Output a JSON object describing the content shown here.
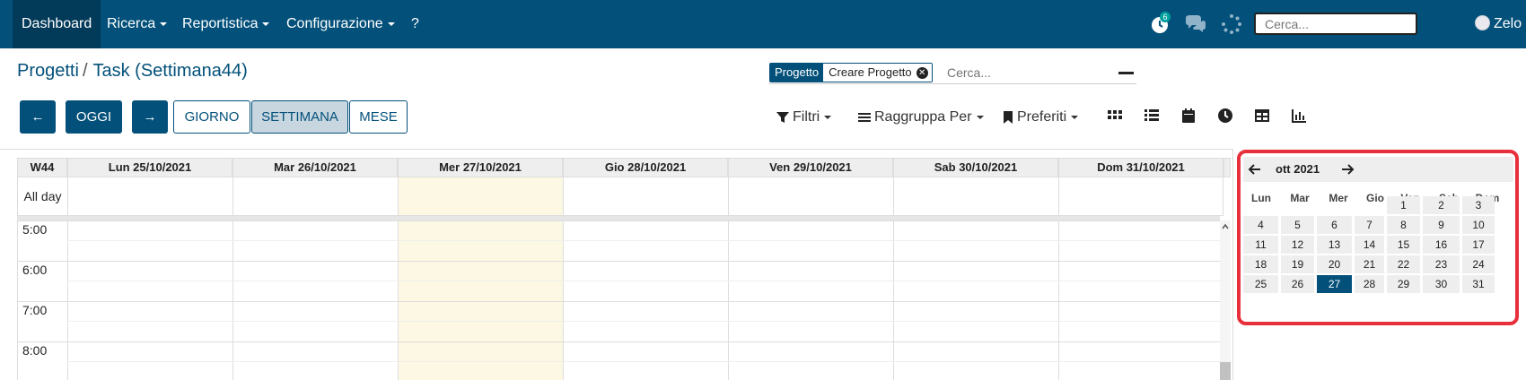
{
  "navbar": {
    "menu": [
      {
        "label": "Dashboard",
        "active": true
      },
      {
        "label": "Ricerca",
        "dropdown": true
      },
      {
        "label": "Reportistica",
        "dropdown": true
      },
      {
        "label": "Configurazione",
        "dropdown": true
      },
      {
        "label": "?"
      }
    ],
    "activity_badge": "6",
    "search_placeholder": "Cerca...",
    "user_name": "Zelo",
    "color": "#03507a"
  },
  "breadcrumb": {
    "parent": "Progetti",
    "separator": "/",
    "current": "Task (Settimana44)"
  },
  "search": {
    "facet_category": "Progetto",
    "facet_value": "Creare Progetto",
    "placeholder": "Cerca..."
  },
  "buttons": {
    "prev": "←",
    "today": "OGGI",
    "next": "→",
    "scales": [
      {
        "label": "GIORNO",
        "active": false
      },
      {
        "label": "SETTIMANA",
        "active": true
      },
      {
        "label": "MESE",
        "active": false
      }
    ]
  },
  "filters": {
    "filters_label": "Filtri",
    "groupby_label": "Raggruppa Per",
    "favorites_label": "Preferiti"
  },
  "views": [
    "kanban-icon",
    "list-icon",
    "calendar-icon",
    "activity-icon",
    "pivot-icon",
    "graph-icon"
  ],
  "calendar": {
    "week_label": "W44",
    "days": [
      "Lun 25/10/2021",
      "Mar 26/10/2021",
      "Mer 27/10/2021",
      "Gio 28/10/2021",
      "Ven 29/10/2021",
      "Sab 30/10/2021",
      "Dom 31/10/2021"
    ],
    "today_index": 2,
    "allday_label": "All day",
    "hours": [
      "5:00",
      "6:00",
      "7:00",
      "8:00"
    ]
  },
  "mini_calendar": {
    "title": "ott 2021",
    "weekdays": [
      "Lun",
      "Mar",
      "Mer",
      "Gio",
      "Ven",
      "Sab",
      "Dom"
    ],
    "weeks": [
      [
        "",
        "",
        "",
        "",
        "1",
        "2",
        "3"
      ],
      [
        "4",
        "5",
        "6",
        "7",
        "8",
        "9",
        "10"
      ],
      [
        "11",
        "12",
        "13",
        "14",
        "15",
        "16",
        "17"
      ],
      [
        "18",
        "19",
        "20",
        "21",
        "22",
        "23",
        "24"
      ],
      [
        "25",
        "26",
        "27",
        "28",
        "29",
        "30",
        "31"
      ]
    ],
    "selected_day": "27",
    "highlight_color": "#e8303c"
  }
}
